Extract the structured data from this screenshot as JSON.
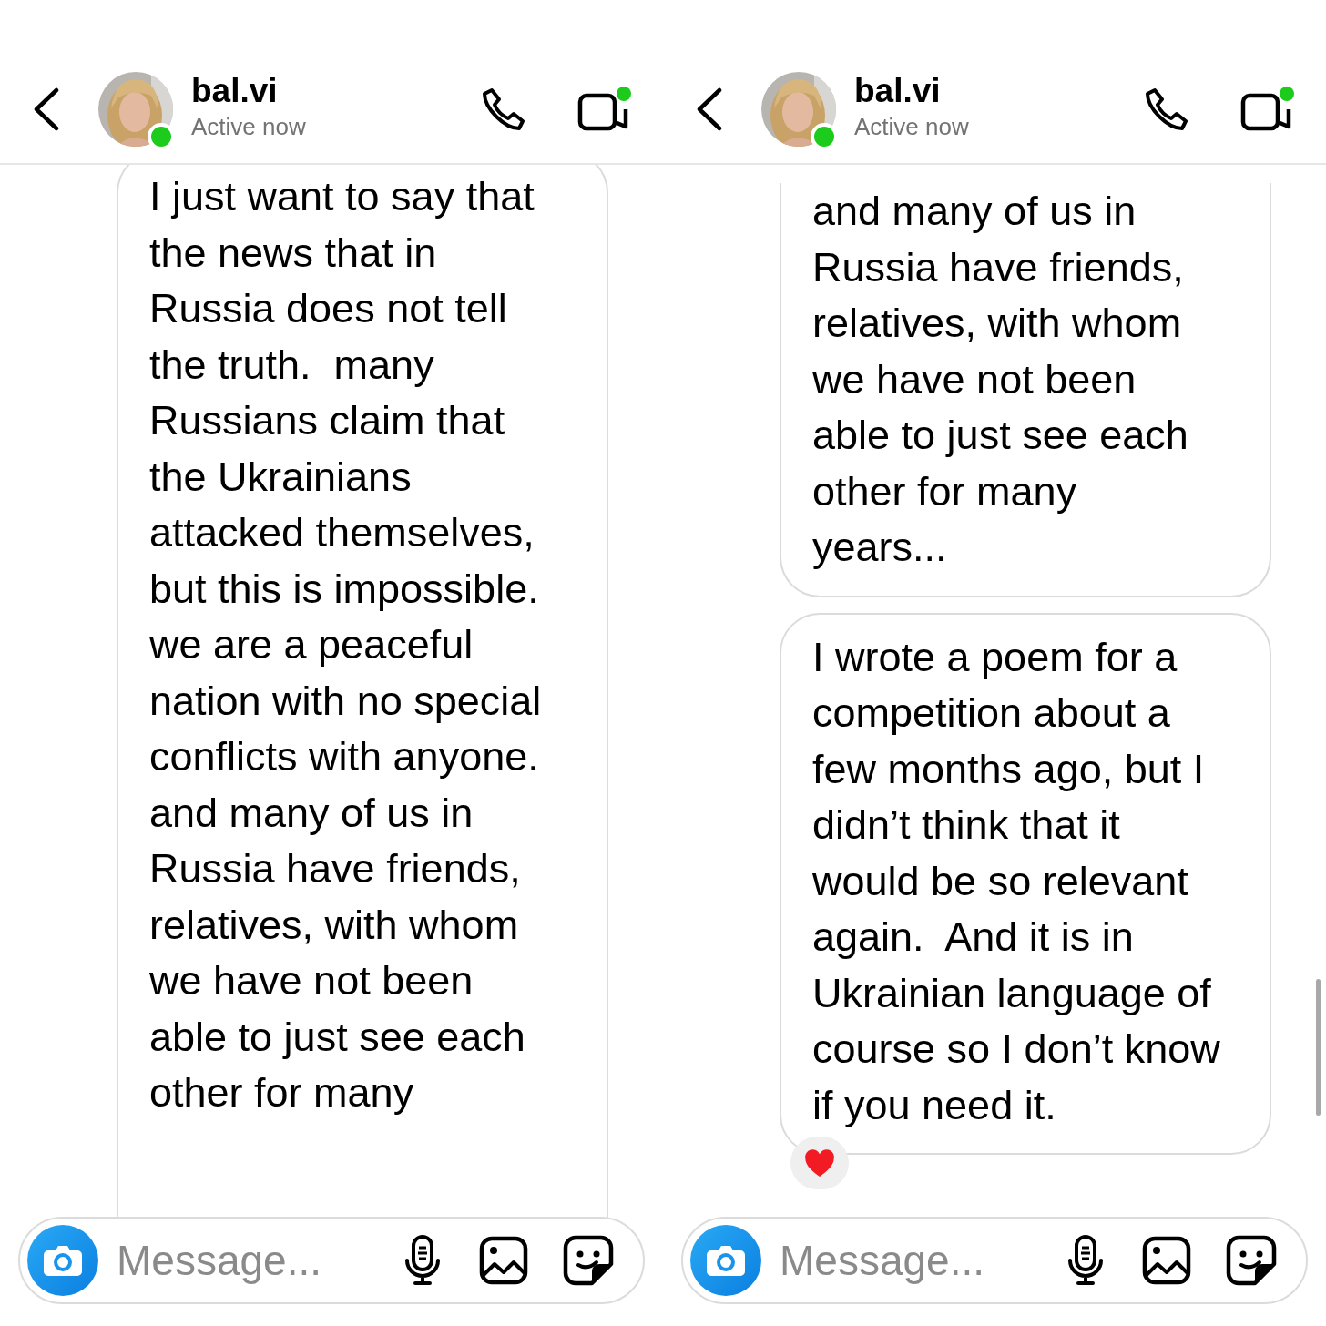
{
  "screens": [
    {
      "header": {
        "username": "bal.vi",
        "status": "Active now",
        "online": true,
        "video_call_dot": true
      },
      "messages": [
        {
          "continues_above": false,
          "continues_below": true,
          "paragraphs": [
            "I just want to say that the news that in Russia does not tell the truth.  many Russians claim that the Ukrainians attacked themselves, but this is impossible.  we are a peaceful nation with no special conflicts with anyone.",
            "and many of us in Russia have friends, relatives, with whom we have not been able to just see each other for many"
          ]
        }
      ],
      "composer": {
        "placeholder": "Message..."
      }
    },
    {
      "header": {
        "username": "bal.vi",
        "status": "Active now",
        "online": true,
        "video_call_dot": true
      },
      "messages": [
        {
          "continues_above": true,
          "continues_below": false,
          "paragraphs": [
            "and many of us in Russia have friends, relatives, with whom we have not been able to just see each other for many years..."
          ]
        },
        {
          "continues_above": false,
          "continues_below": false,
          "paragraphs": [
            "I wrote a poem for a competition about a few months ago, but I didn’t think that it would be so relevant again.  And it is in Ukrainian language of course so I don’t know if you need it."
          ],
          "reaction": {
            "kind": "heart"
          }
        }
      ],
      "composer": {
        "placeholder": "Message..."
      },
      "scrollbar": true
    }
  ]
}
